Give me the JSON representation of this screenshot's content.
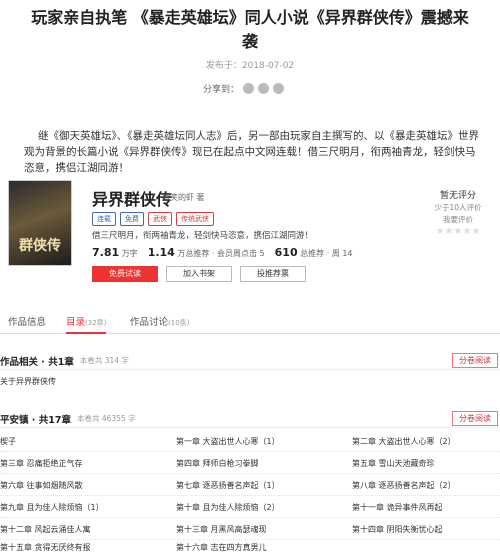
{
  "article": {
    "title": "玩家亲自执笔 《暴走英雄坛》同人小说《异界群侠传》震撼来袭",
    "publish_label": "发布于：",
    "date": "2018-07-02",
    "share_label": "分享到：",
    "intro": "继《御天英雄坛》、《暴走英雄坛同人志》后，另一部由玩家自主撰写的、以《暴走英雄坛》世界观为背景的长篇小说《异界群侠传》现已在起点中文网连载！借三尺明月，衔两袖青龙，轻剑快马恣意，携侣江湖同游！"
  },
  "book": {
    "name": "异界群侠传",
    "author": "微笑的虾 著",
    "cover_text": "群侠传",
    "tags": [
      "连载",
      "免费",
      "武侠",
      "传统武侠"
    ],
    "desc": "借三尺明月，衔两袖青龙，轻剑快马恣意，携侣江湖同游！",
    "stats": [
      {
        "value": "7.81",
        "unit": "万字"
      },
      {
        "value": "1.14",
        "unit": "万总推荐 · 会员周点击 5"
      },
      {
        "value": "610",
        "unit": "总推荐 · 周 14"
      }
    ],
    "buttons": [
      "免费试读",
      "加入书架",
      "投推荐票"
    ],
    "score": {
      "title": "暂无评分",
      "sub": "少于10人评价",
      "rate": "我要评价",
      "stars": "★★★★★"
    }
  },
  "tabs": [
    {
      "label": "作品信息",
      "count": ""
    },
    {
      "label": "目录",
      "count": "(32章)"
    },
    {
      "label": "作品讨论",
      "count": "(10条)"
    }
  ],
  "volumes": [
    {
      "name": "作品相关 · 共1章",
      "info": "本卷共 314 字",
      "read": "分卷阅读",
      "chapters": [
        "关于异界群侠传"
      ]
    },
    {
      "name": "平安镇 · 共17章",
      "info": "本卷共 46355 字",
      "read": "分卷阅读",
      "chapters": [
        "楔子",
        "第一章 大盗出世人心寒（1）",
        "第二章 大盗出世人心寒（2）",
        "第三章 忍痛拒绝正气存",
        "第四章 拜师白枪习拳脚",
        "第五章 雪山天池藏奇珍",
        "第六章 往事如烟随风散",
        "第七章 逐恶扬善名声起（1）",
        "第八章 逐恶扬善名声起（2）",
        "第九章 且为佳人除烦恼（1）",
        "第十章 且为佳人除烦恼（2）",
        "第十一章 诡异事件风再起",
        "第十二章 风起云涌佳人寓",
        "第十三章 月黑风高瑟魂现",
        "第十四章 阴阳失衡忧心起",
        "第十五章 贪得无厌终有报",
        "第十六章 志在四方真男儿"
      ]
    }
  ]
}
